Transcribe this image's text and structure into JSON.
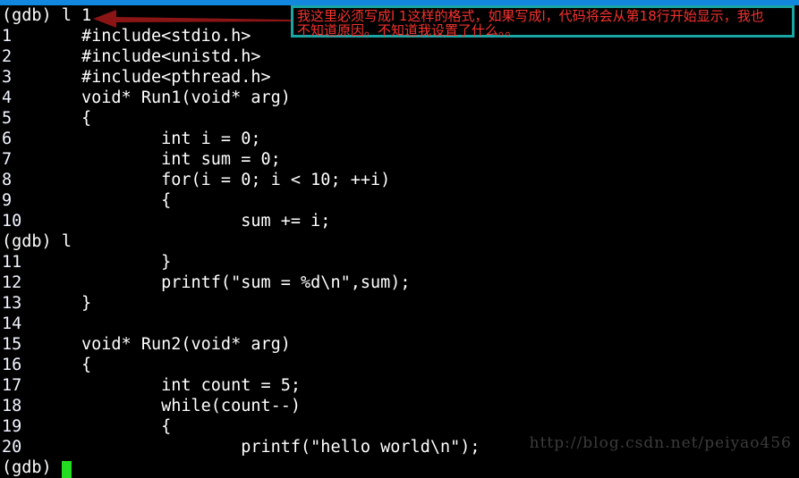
{
  "window": {
    "titlebar_color": "#1188dd",
    "background_color": "#000000"
  },
  "terminal": {
    "foreground_color": "#ffffff",
    "lineno_color": "#f0f4ff",
    "cursor_color": "#22dd22",
    "lines": [
      {
        "type": "prompt",
        "text": "(gdb) l 1"
      },
      {
        "type": "code",
        "lineno": "1",
        "code": "#include<stdio.h>"
      },
      {
        "type": "code",
        "lineno": "2",
        "code": "#include<unistd.h>"
      },
      {
        "type": "code",
        "lineno": "3",
        "code": "#include<pthread.h>"
      },
      {
        "type": "code",
        "lineno": "4",
        "code": "void* Run1(void* arg)"
      },
      {
        "type": "code",
        "lineno": "5",
        "code": "{"
      },
      {
        "type": "code",
        "lineno": "6",
        "code": "        int i = 0;"
      },
      {
        "type": "code",
        "lineno": "7",
        "code": "        int sum = 0;"
      },
      {
        "type": "code",
        "lineno": "8",
        "code": "        for(i = 0; i < 10; ++i)"
      },
      {
        "type": "code",
        "lineno": "9",
        "code": "        {"
      },
      {
        "type": "code",
        "lineno": "10",
        "code": "                sum += i;"
      },
      {
        "type": "prompt",
        "text": "(gdb) l"
      },
      {
        "type": "code",
        "lineno": "11",
        "code": "        }"
      },
      {
        "type": "code",
        "lineno": "12",
        "code": "        printf(\"sum = %d\\n\",sum);"
      },
      {
        "type": "code",
        "lineno": "13",
        "code": "}"
      },
      {
        "type": "code",
        "lineno": "14",
        "code": ""
      },
      {
        "type": "code",
        "lineno": "15",
        "code": "void* Run2(void* arg)"
      },
      {
        "type": "code",
        "lineno": "16",
        "code": "{"
      },
      {
        "type": "code",
        "lineno": "17",
        "code": "        int count = 5;"
      },
      {
        "type": "code",
        "lineno": "18",
        "code": "        while(count--)"
      },
      {
        "type": "code",
        "lineno": "19",
        "code": "        {"
      },
      {
        "type": "code",
        "lineno": "20",
        "code": "                printf(\"hello world\\n\");"
      },
      {
        "type": "prompt-cursor",
        "text": "(gdb) "
      }
    ]
  },
  "annotation": {
    "arrow_color": "#8b1515",
    "callout_border_color": "#1aa5a5",
    "callout_text_color": "#f4322e",
    "callout_lines": [
      "我这里必须写成l 1这样的格式，如果写成l，代码将会从第18行开始显示，我也",
      "不知道原因。不知道我设置了什么。。"
    ]
  },
  "watermark": {
    "text": "http://blog.csdn.net/peiyao456",
    "color": "#3c3c3c"
  }
}
